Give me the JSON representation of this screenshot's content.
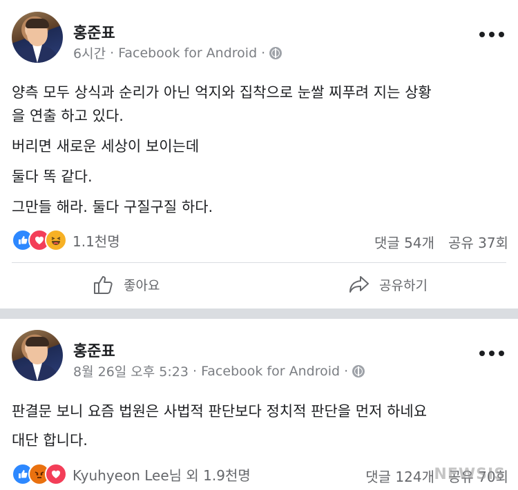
{
  "posts": [
    {
      "author": "홍준표",
      "time": "6시간",
      "source": "Facebook for Android",
      "lines": [
        "양측 모두 상식과 순리가 아닌 억지와 집착으로 눈쌀 찌푸려 지는 상황",
        "을 연출 하고 있다.",
        "버리면 새로운 세상이 보이는데",
        "둘다 똑 같다.",
        "그만들 해라. 둘다 구질구질 하다."
      ],
      "reaction_icons": [
        "like-icon",
        "love-icon",
        "haha-icon"
      ],
      "reaction_count": "1.1천명",
      "comments": "댓글 54개",
      "shares": "공유 37회",
      "like_label": "좋아요",
      "share_label": "공유하기"
    },
    {
      "author": "홍준표",
      "time": "8월 26일 오후 5:23",
      "source": "Facebook for Android",
      "lines": [
        "판결문 보니 요즘 법원은 사법적 판단보다 정치적 판단을 먼저 하네요",
        "대단 합니다."
      ],
      "reaction_icons": [
        "like-icon",
        "angry-icon",
        "love-icon"
      ],
      "reaction_count": "Kyuhyeon Lee님 외 1.9천명",
      "comments": "댓글 124개",
      "shares": "공유 70회"
    }
  ],
  "watermark": "NEWSIS",
  "colors": {
    "like": "#2d88ff",
    "love": "#f33e58",
    "haha": "#f7b125",
    "angry": "#e9710f",
    "separator": "#dadde1"
  }
}
